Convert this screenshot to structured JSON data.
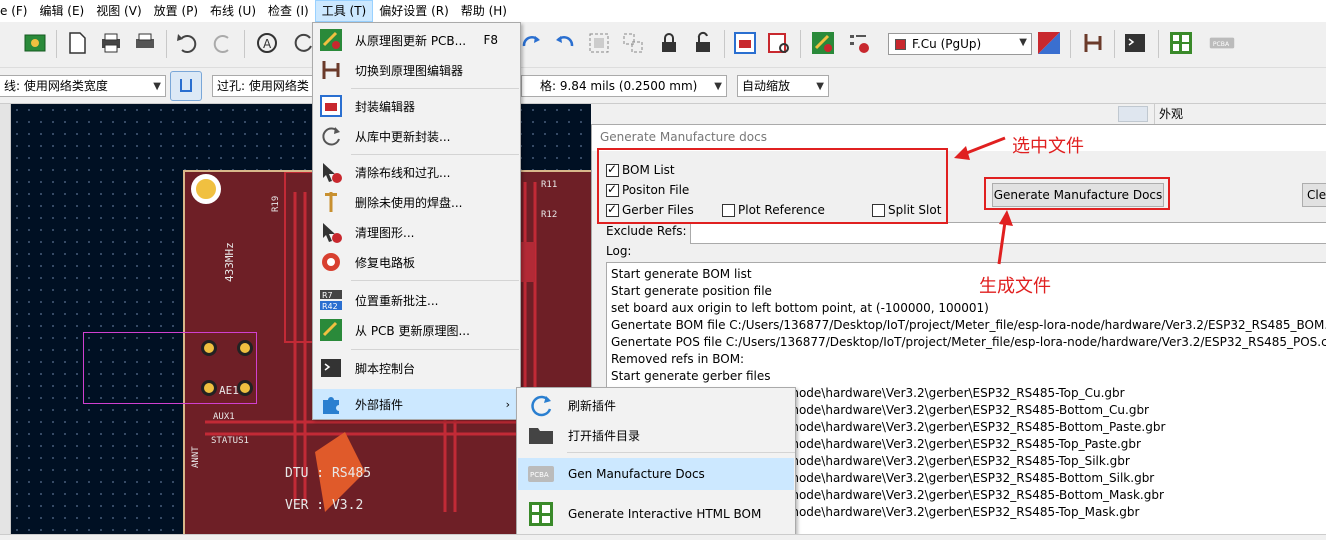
{
  "menubar": {
    "items": [
      "e (F)",
      "编辑 (E)",
      "视图 (V)",
      "放置 (P)",
      "布线 (U)",
      "检查 (I)",
      "工具 (T)",
      "偏好设置 (R)",
      "帮助 (H)"
    ]
  },
  "toolbar": {
    "layer_select": "F.Cu (PgUp)"
  },
  "toolbar2": {
    "track_width": "线: 使用网络类宽度",
    "via_size": "过孔: 使用网络类",
    "grid": "格: 9.84 mils (0.2500 mm)",
    "zoom": "自动缩放"
  },
  "appearance": {
    "title": "外观"
  },
  "pcb": {
    "silk_labels": [
      "433MHz",
      "AE1",
      "AUX1",
      "STATUS1",
      "ANNT",
      "R19",
      "R11",
      "R12",
      "DTU : RS485",
      "VER : V3.2"
    ]
  },
  "tools_menu": {
    "items": [
      {
        "label": "从原理图更新 PCB...",
        "shortcut": "F8",
        "icon": "update-pcb-icon"
      },
      {
        "label": "切换到原理图编辑器",
        "icon": "schematic-icon"
      },
      {
        "label": "封装编辑器",
        "icon": "footprint-editor-icon"
      },
      {
        "label": "从库中更新封装...",
        "icon": "refresh-footprint-icon"
      },
      {
        "label": "清除布线和过孔...",
        "icon": "cleanup-tracks-icon"
      },
      {
        "label": "删除未使用的焊盘...",
        "icon": "remove-pads-icon"
      },
      {
        "label": "清理图形...",
        "icon": "cleanup-graphics-icon"
      },
      {
        "label": "修复电路板",
        "icon": "repair-board-icon"
      },
      {
        "label": "位置重新批注...",
        "icon": "reannotate-icon"
      },
      {
        "label": "从 PCB 更新原理图...",
        "icon": "update-schematic-icon"
      },
      {
        "label": "脚本控制台",
        "icon": "console-icon"
      },
      {
        "label": "外部插件",
        "icon": "plugin-icon"
      }
    ]
  },
  "plugin_submenu": {
    "items": [
      {
        "label": "刷新插件",
        "icon": "refresh-icon"
      },
      {
        "label": "打开插件目录",
        "icon": "folder-icon"
      },
      {
        "label": "Gen Manufacture Docs",
        "icon": "pcba-icon"
      },
      {
        "label": "Generate Interactive HTML BOM",
        "icon": "ibom-icon"
      }
    ]
  },
  "dialog": {
    "title": "Generate Manufacture docs",
    "checkboxes": {
      "bom_list": {
        "label": "BOM List",
        "checked": true
      },
      "position_file": {
        "label": "Positon File",
        "checked": true
      },
      "gerber_files": {
        "label": "Gerber Files",
        "checked": true
      },
      "plot_reference": {
        "label": "Plot Reference",
        "checked": false
      },
      "split_slot": {
        "label": "Split Slot",
        "checked": false
      }
    },
    "generate_button": "Generate Manufacture Docs",
    "clear_button": "Clea",
    "exclude_label": "Exclude Refs:",
    "exclude_value": "",
    "log_label": "Log:",
    "log_lines": [
      "Start generate BOM list",
      "Start generate position file",
      "set board aux origin to left bottom point, at (-100000, 100001)",
      "Genertate BOM file  C:/Users/136877/Desktop/IoT/project/Meter_file/esp-lora-node/hardware/Ver3.2/ESP32_RS485_BOM.c",
      "Genertate POS file  C:/Users/136877/Desktop/IoT/project/Meter_file/esp-lora-node/hardware/Ver3.2/ESP32_RS485_POS.csv",
      "Removed refs in BOM:",
      "Start generate gerber files",
      "oT\\project\\Meter_file\\esp-lora-node\\hardware\\Ver3.2\\gerber\\ESP32_RS485-Top_Cu.gbr",
      "oT\\project\\Meter_file\\esp-lora-node\\hardware\\Ver3.2\\gerber\\ESP32_RS485-Bottom_Cu.gbr",
      "oT\\project\\Meter_file\\esp-lora-node\\hardware\\Ver3.2\\gerber\\ESP32_RS485-Bottom_Paste.gbr",
      "oT\\project\\Meter_file\\esp-lora-node\\hardware\\Ver3.2\\gerber\\ESP32_RS485-Top_Paste.gbr",
      "oT\\project\\Meter_file\\esp-lora-node\\hardware\\Ver3.2\\gerber\\ESP32_RS485-Top_Silk.gbr",
      "oT\\project\\Meter_file\\esp-lora-node\\hardware\\Ver3.2\\gerber\\ESP32_RS485-Bottom_Silk.gbr",
      "oT\\project\\Meter_file\\esp-lora-node\\hardware\\Ver3.2\\gerber\\ESP32_RS485-Bottom_Mask.gbr",
      "oT\\project\\Meter_file\\esp-lora-node\\hardware\\Ver3.2\\gerber\\ESP32_RS485-Top_Mask.gbr"
    ]
  },
  "annotations": {
    "select_files": "选中文件",
    "generate_files": "生成文件"
  },
  "colors": {
    "annotation_red": "#e02020",
    "menu_highlight": "#cce8ff",
    "pcb_background": "#001023",
    "board_fill": "#6e1f26",
    "layer_fcu": "#c8282e"
  }
}
